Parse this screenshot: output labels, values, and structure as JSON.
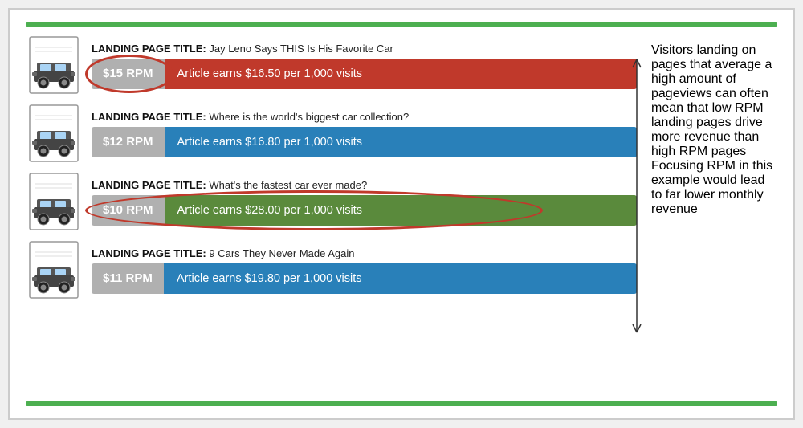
{
  "topBar": {
    "color": "#4caf50"
  },
  "cards": [
    {
      "id": "card1",
      "title_label": "LANDING PAGE TITLE:",
      "title_value": " Jay Leno Says THIS Is His Favorite Car",
      "rpm": "$15 RPM",
      "earnings": "Article earns $16.50 per 1,000 visits",
      "barColor": "bar-red",
      "hasOval": "rpm",
      "ovalFull": false
    },
    {
      "id": "card2",
      "title_label": "LANDING PAGE TITLE:",
      "title_value": " Where is the world's biggest car collection?",
      "rpm": "$12 RPM",
      "earnings": "Article earns $16.80 per 1,000 visits",
      "barColor": "bar-blue",
      "hasOval": false,
      "ovalFull": false
    },
    {
      "id": "card3",
      "title_label": "LANDING PAGE TITLE:",
      "title_value": " What's the fastest car ever made?",
      "rpm": "$10 RPM",
      "earnings": "Article earns $28.00 per 1,000 visits",
      "barColor": "bar-green",
      "hasOval": "full",
      "ovalFull": true
    },
    {
      "id": "card4",
      "title_label": "LANDING PAGE TITLE:",
      "title_value": " 9 Cars They Never Made Again",
      "rpm": "$11 RPM",
      "earnings": "Article earns $19.80 per 1,000 visits",
      "barColor": "bar-blue2",
      "hasOval": false,
      "ovalFull": false
    }
  ],
  "sideText": {
    "main": "Visitors landing on pages that average a high amount of pageviews can often mean that low RPM landing pages drive more revenue than high RPM pages",
    "warning": "Focusing RPM in this example would lead to far lower monthly revenue"
  }
}
